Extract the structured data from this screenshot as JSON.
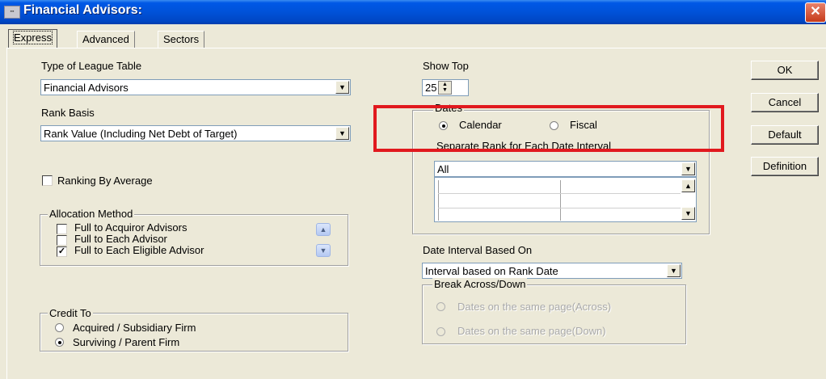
{
  "window": {
    "title": "Financial Advisors:",
    "icon": "app-icon",
    "close_glyph": "✕"
  },
  "tabs": [
    {
      "label": "Express",
      "active": true
    },
    {
      "label": "Advanced"
    },
    {
      "label": "Sectors"
    }
  ],
  "league_table": {
    "label": "Type of League Table",
    "value": "Financial Advisors"
  },
  "rank_basis": {
    "label": "Rank Basis",
    "value": "Rank Value (Including Net Debt of Target)"
  },
  "ranking_by_average": {
    "label": "Ranking By Average",
    "checked": false
  },
  "allocation": {
    "legend": "Allocation Method",
    "items": [
      {
        "label": "Full to Acquiror Advisors",
        "checked": false
      },
      {
        "label": "Full to Each Advisor",
        "checked": false
      },
      {
        "label": "Full to Each Eligible Advisor",
        "checked": true
      }
    ]
  },
  "credit_to": {
    "legend": "Credit To",
    "options": [
      {
        "label": "Acquired / Subsidiary Firm",
        "selected": false
      },
      {
        "label": "Surviving / Parent Firm",
        "selected": true
      }
    ]
  },
  "show_top": {
    "label": "Show Top",
    "value": "25"
  },
  "dates": {
    "legend": "Dates",
    "options": [
      {
        "label": "Calendar",
        "selected": true
      },
      {
        "label": "Fiscal",
        "selected": false
      }
    ],
    "separate_label": "Separate Rank for Each Date Interval",
    "interval_value": "All"
  },
  "date_interval": {
    "label": "Date Interval Based On",
    "value": "Interval based on Rank Date"
  },
  "break_across": {
    "legend": "Break Across/Down",
    "options": [
      {
        "label": "Dates on the same page(Across)"
      },
      {
        "label": "Dates on the same page(Down)"
      }
    ]
  },
  "buttons": {
    "ok": "OK",
    "cancel": "Cancel",
    "default": "Default",
    "definition": "Definition"
  },
  "annotation_color": "#e1191e"
}
